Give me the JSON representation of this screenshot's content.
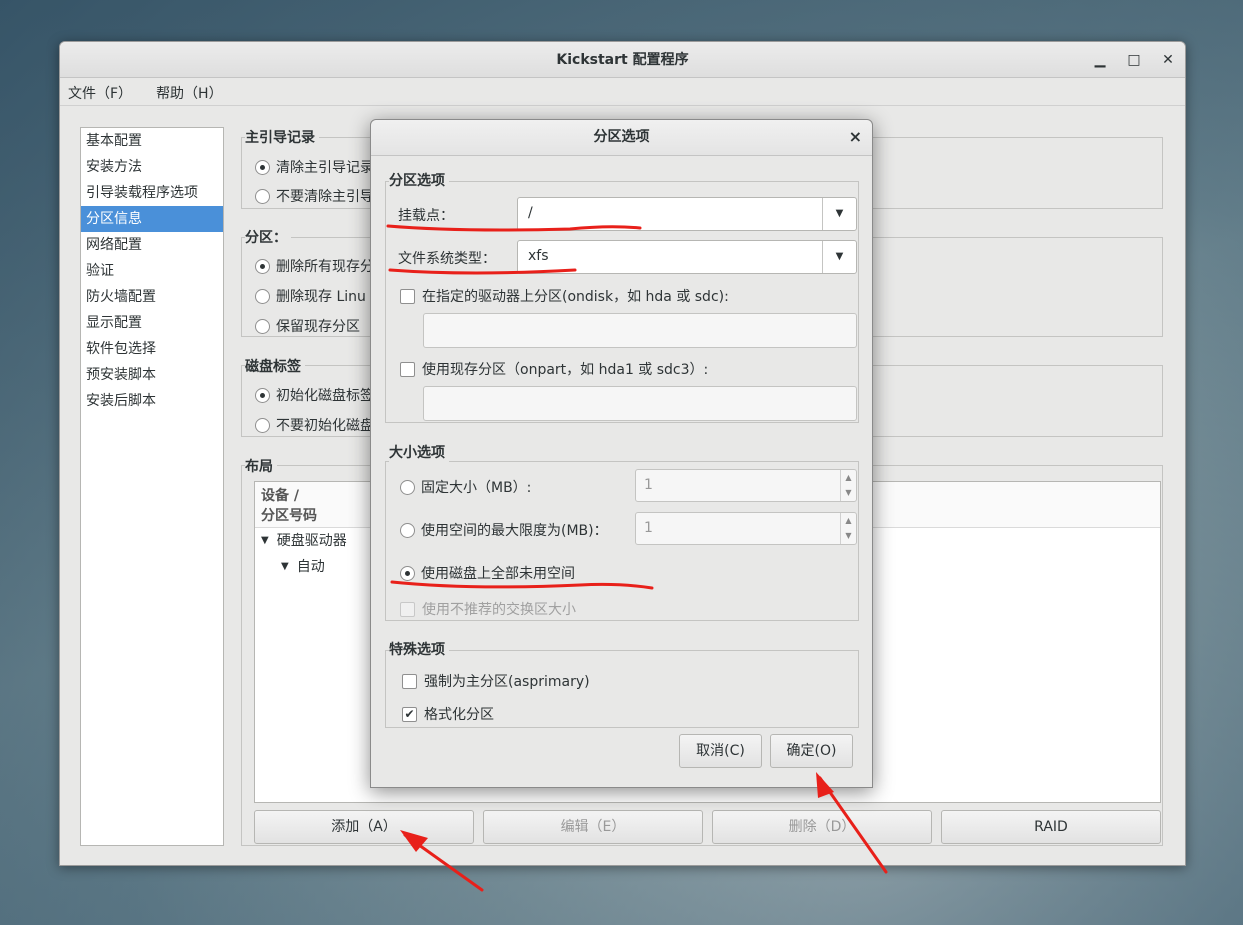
{
  "window": {
    "title": "Kickstart 配置程序",
    "controls": {
      "minimize": "▁",
      "maximize": "□",
      "close": "✕"
    }
  },
  "menubar": {
    "file": "文件（F）",
    "help": "帮助（H）"
  },
  "sidebar": {
    "items": [
      {
        "label": "基本配置"
      },
      {
        "label": "安装方法"
      },
      {
        "label": "引导装载程序选项"
      },
      {
        "label": "分区信息"
      },
      {
        "label": "网络配置"
      },
      {
        "label": "验证"
      },
      {
        "label": "防火墙配置"
      },
      {
        "label": "显示配置"
      },
      {
        "label": "软件包选择"
      },
      {
        "label": "预安装脚本"
      },
      {
        "label": "安装后脚本"
      }
    ],
    "selected_index": 3
  },
  "main": {
    "mbr_title": "主引导记录",
    "mbr_opt1": "清除主引导记录",
    "mbr_opt2": "不要清除主引导",
    "part_title": "分区：",
    "part_opt1": "删除所有现存分",
    "part_opt2": "删除现存 Linu",
    "part_opt3": "保留现存分区",
    "label_title": "磁盘标签",
    "label_opt1": "初始化磁盘标签",
    "label_opt2": "不要初始化磁盘",
    "layout_title": "布局",
    "layout_header_1": "设备 /",
    "layout_header_2": "分区号码",
    "tree_root": "硬盘驱动器",
    "tree_child": "自动",
    "buttons": {
      "add": "添加（A）",
      "edit": "编辑（E）",
      "delete": "删除（D）",
      "raid": "RAID"
    }
  },
  "dialog": {
    "title": "分区选项",
    "close": "×",
    "group_part": "分区选项",
    "mount_label": "挂载点：",
    "mount_value": "/",
    "fstype_label": "文件系统类型：",
    "fstype_value": "xfs",
    "ondisk_label": "在指定的驱动器上分区(ondisk，如 hda 或 sdc):",
    "onpart_label": "使用现存分区（onpart，如 hda1 或 sdc3）:",
    "group_size": "大小选项",
    "fixed_label": "固定大小（MB）:",
    "fixed_value": "1",
    "max_label": "使用空间的最大限度为(MB)：",
    "max_value": "1",
    "fill_label": "使用磁盘上全部未用空间",
    "swap_label": "使用不推荐的交换区大小",
    "group_special": "特殊选项",
    "primary_label": "强制为主分区(asprimary)",
    "format_label": "格式化分区",
    "cancel": "取消(C)",
    "ok": "确定(O)"
  },
  "annotation_color": "#e8201a"
}
